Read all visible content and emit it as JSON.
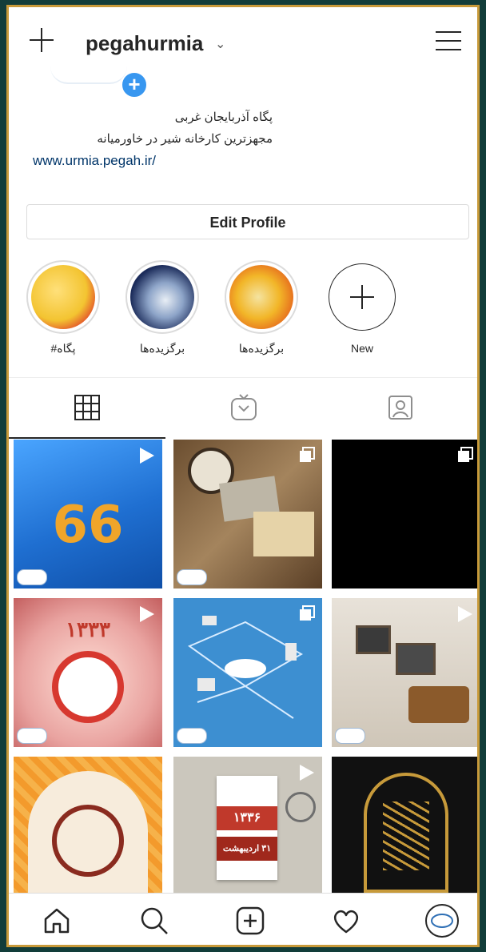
{
  "header": {
    "username": "pegahurmia",
    "dropdown_glyph": "⌄"
  },
  "profile": {
    "bio_line1": "پگاه آذربایجان غربی",
    "bio_line2": "مجهزترین کارخانه شیر در خاورمیانه",
    "website": "www.urmia.pegah.ir/",
    "edit_label": "Edit Profile"
  },
  "highlights": [
    {
      "label": "#پگاه",
      "color": "#f3c431"
    },
    {
      "label": "برگزیده‌ها",
      "color": "#1b2b5a"
    },
    {
      "label": "برگزیده‌ها",
      "color": "#f2b628"
    },
    {
      "label": "New"
    }
  ],
  "tabs": [
    "grid-icon",
    "igtv-icon",
    "tagged-icon"
  ],
  "posts": [
    {
      "name": "post-66",
      "bg": "#1f6fd1",
      "badge": "play",
      "caption": "66"
    },
    {
      "name": "post-vintage-desk",
      "bg": "#8a6a45",
      "badge": "multi"
    },
    {
      "name": "post-black",
      "bg": "#000000",
      "badge": "multi"
    },
    {
      "name": "post-clock",
      "bg": "#e9a3a0",
      "badge": "play",
      "caption": "۱۳۳۳"
    },
    {
      "name": "post-infographic",
      "bg": "#3d8fd1",
      "badge": "multi"
    },
    {
      "name": "post-radio",
      "bg": "#d9d2c8",
      "badge": "play"
    },
    {
      "name": "post-calligraphy",
      "bg": "#f1902a"
    },
    {
      "name": "post-calendar",
      "bg": "#cbc7bd",
      "badge": "play",
      "caption": "۱۳۳۶"
    },
    {
      "name": "post-dark-calligraphy",
      "bg": "#1a1a1a"
    }
  ],
  "calendar": {
    "year": "۱۳۳۶",
    "date": "۳۱ اردیبهشت"
  },
  "bottom_nav": [
    "home-icon",
    "search-icon",
    "create-icon",
    "activity-heart-icon",
    "profile-avatar-icon"
  ]
}
